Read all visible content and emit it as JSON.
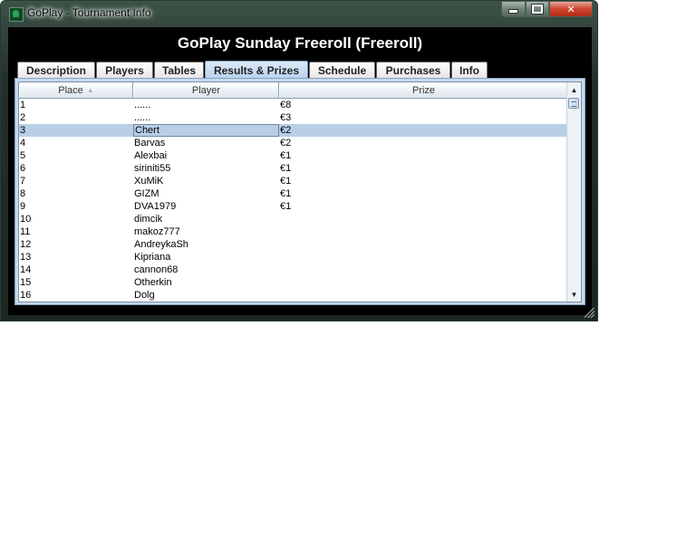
{
  "window": {
    "title": "GoPlay - Tournament Info",
    "controls": {
      "minimize": "minimize",
      "maximize": "maximize",
      "close": "✕"
    }
  },
  "heading": "GoPlay Sunday Freeroll (Freeroll)",
  "tabs": [
    {
      "label": "Description",
      "active": false
    },
    {
      "label": "Players",
      "active": false
    },
    {
      "label": "Tables",
      "active": false
    },
    {
      "label": "Results & Prizes",
      "active": true
    },
    {
      "label": "Schedule",
      "active": false
    },
    {
      "label": "Purchases",
      "active": false
    },
    {
      "label": "Info",
      "active": false
    }
  ],
  "table": {
    "columns": {
      "place": "Place",
      "player": "Player",
      "prize": "Prize"
    },
    "sort_icon": "▲",
    "rows": [
      {
        "place": "1",
        "player": "......",
        "prize": "€8"
      },
      {
        "place": "2",
        "player": "......",
        "prize": "€3"
      },
      {
        "place": "3",
        "player": "Chert",
        "prize": "€2",
        "selected": true
      },
      {
        "place": "4",
        "player": "Barvas",
        "prize": "€2"
      },
      {
        "place": "5",
        "player": "Alexbai",
        "prize": "€1"
      },
      {
        "place": "6",
        "player": "siriniti55",
        "prize": "€1"
      },
      {
        "place": "7",
        "player": "XuMiK",
        "prize": "€1"
      },
      {
        "place": "8",
        "player": "GIZM",
        "prize": "€1"
      },
      {
        "place": "9",
        "player": "DVA1979",
        "prize": "€1"
      },
      {
        "place": "10",
        "player": "dimcik",
        "prize": ""
      },
      {
        "place": "11",
        "player": "makoz777",
        "prize": ""
      },
      {
        "place": "12",
        "player": "AndreykaSh",
        "prize": ""
      },
      {
        "place": "13",
        "player": "Kipriana",
        "prize": ""
      },
      {
        "place": "14",
        "player": "cannon68",
        "prize": ""
      },
      {
        "place": "15",
        "player": "Otherkin",
        "prize": ""
      },
      {
        "place": "16",
        "player": "Dolg",
        "prize": ""
      }
    ]
  },
  "scrollbar": {
    "up_icon": "▲",
    "down_icon": "▼"
  },
  "colors": {
    "selected_row": "#b8cfe6",
    "active_tab": "#b8d2ec",
    "client_background": "#000000"
  }
}
